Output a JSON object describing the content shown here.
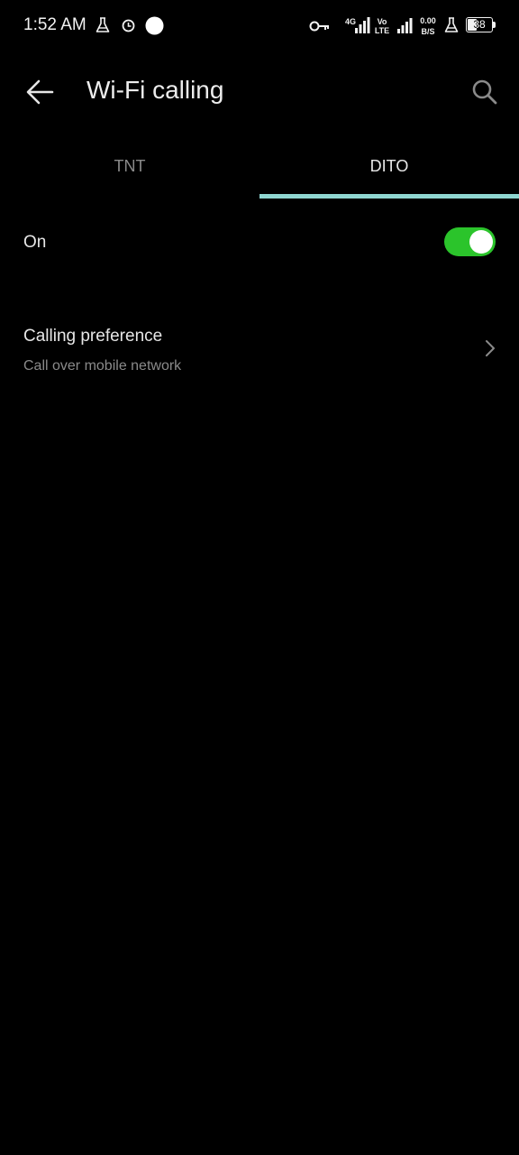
{
  "status_bar": {
    "time": "1:52 AM",
    "network_4g": "4G",
    "volte_top": "Vo",
    "volte_bottom": "LTE",
    "speed_value": "0.00",
    "speed_unit": "B/S",
    "battery_level": "38",
    "battery_fraction": 0.38,
    "icons": [
      "lab-flask-icon",
      "alarm-icon",
      "dot-icon",
      "vpn-key-icon",
      "signal-icon",
      "signal-icon",
      "lab-flask-icon",
      "battery-icon"
    ]
  },
  "app_bar": {
    "title": "Wi-Fi calling",
    "back_icon": "arrow-back-icon",
    "search_icon": "search-icon"
  },
  "tabs": [
    {
      "label": "TNT",
      "selected": false
    },
    {
      "label": "DITO",
      "selected": true
    }
  ],
  "settings": {
    "on_label": "On",
    "on_toggle_state": true,
    "calling_pref_title": "Calling preference",
    "calling_pref_value": "Call over mobile network"
  },
  "colors": {
    "background": "#000000",
    "accent_tab": "#8fd6d1",
    "toggle_on": "#2bc42b"
  }
}
